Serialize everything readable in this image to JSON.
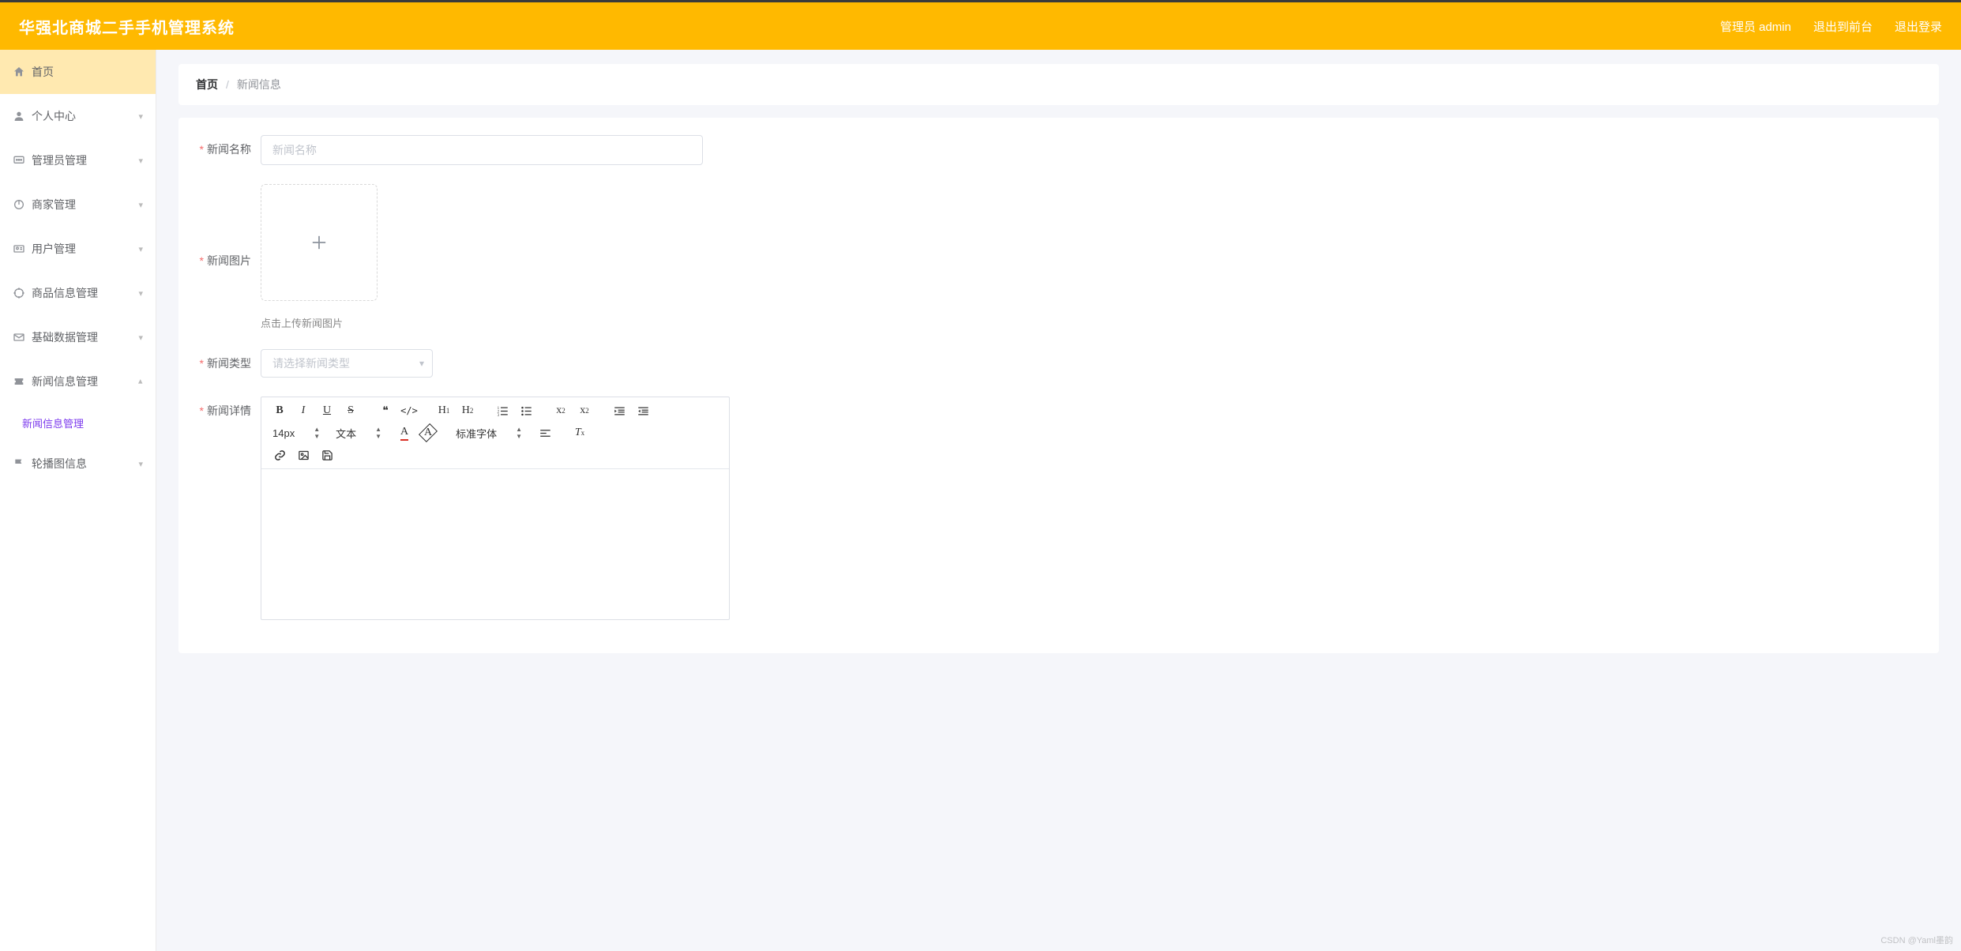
{
  "header": {
    "title": "华强北商城二手手机管理系统",
    "links": {
      "admin": "管理员 admin",
      "to_front": "退出到前台",
      "logout": "退出登录"
    }
  },
  "sidebar": {
    "items": [
      {
        "icon": "home",
        "label": "首页",
        "active": true
      },
      {
        "icon": "user",
        "label": "个人中心",
        "expand": true
      },
      {
        "icon": "chat",
        "label": "管理员管理",
        "expand": true
      },
      {
        "icon": "power",
        "label": "商家管理",
        "expand": true
      },
      {
        "icon": "id",
        "label": "用户管理",
        "expand": true
      },
      {
        "icon": "target",
        "label": "商品信息管理",
        "expand": true
      },
      {
        "icon": "mail",
        "label": "基础数据管理",
        "expand": true
      },
      {
        "icon": "ticket",
        "label": "新闻信息管理",
        "expand": true,
        "open": true,
        "children": [
          {
            "label": "新闻信息管理"
          }
        ]
      },
      {
        "icon": "flag",
        "label": "轮播图信息",
        "expand": true
      }
    ]
  },
  "breadcrumb": {
    "root": "首页",
    "sep": "/",
    "current": "新闻信息"
  },
  "form": {
    "news_name": {
      "label": "新闻名称",
      "placeholder": "新闻名称",
      "value": ""
    },
    "news_image": {
      "label": "新闻图片",
      "hint": "点击上传新闻图片"
    },
    "news_type": {
      "label": "新闻类型",
      "placeholder": "请选择新闻类型",
      "value": ""
    },
    "news_detail": {
      "label": "新闻详情"
    }
  },
  "editor": {
    "font_size": "14px",
    "block": "文本",
    "font_family": "标准字体"
  },
  "watermark": "CSDN @Yaml墨韵"
}
